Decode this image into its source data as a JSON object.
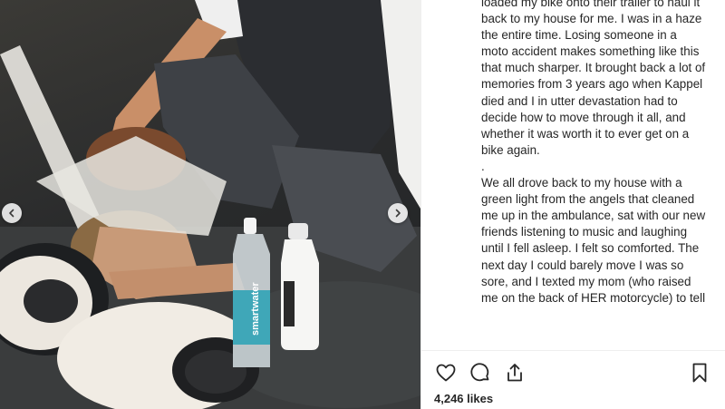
{
  "caption": {
    "paragraph1": "loaded my bike onto their trailer to haul it back to my house for me. I was in a haze the entire time. Losing someone in a moto accident makes something like this that much sharper. It brought back a lot of memories from 3 years ago when Kappel died and I in utter devastation had to decide how to move through it all, and whether it was worth it to ever get on a bike again.",
    "separator": ".",
    "paragraph2": "We all drove back to my house with a green light from the angels that cleaned me up in the ambulance, sat with our new friends listening to music and laughing until I fell asleep. I felt so comforted. The next day I could barely move I was so sore, and I texted my mom (who raised me on the back of HER motorcycle) to tell"
  },
  "photo": {
    "bottle_label": "smartwater"
  },
  "actions": {
    "icons": [
      "heart-icon",
      "comment-icon",
      "share-icon",
      "bookmark-icon"
    ]
  },
  "likes": {
    "text": "4,246 likes"
  },
  "colors": {
    "text": "#262626",
    "divider": "#efefef",
    "background": "#ffffff"
  }
}
